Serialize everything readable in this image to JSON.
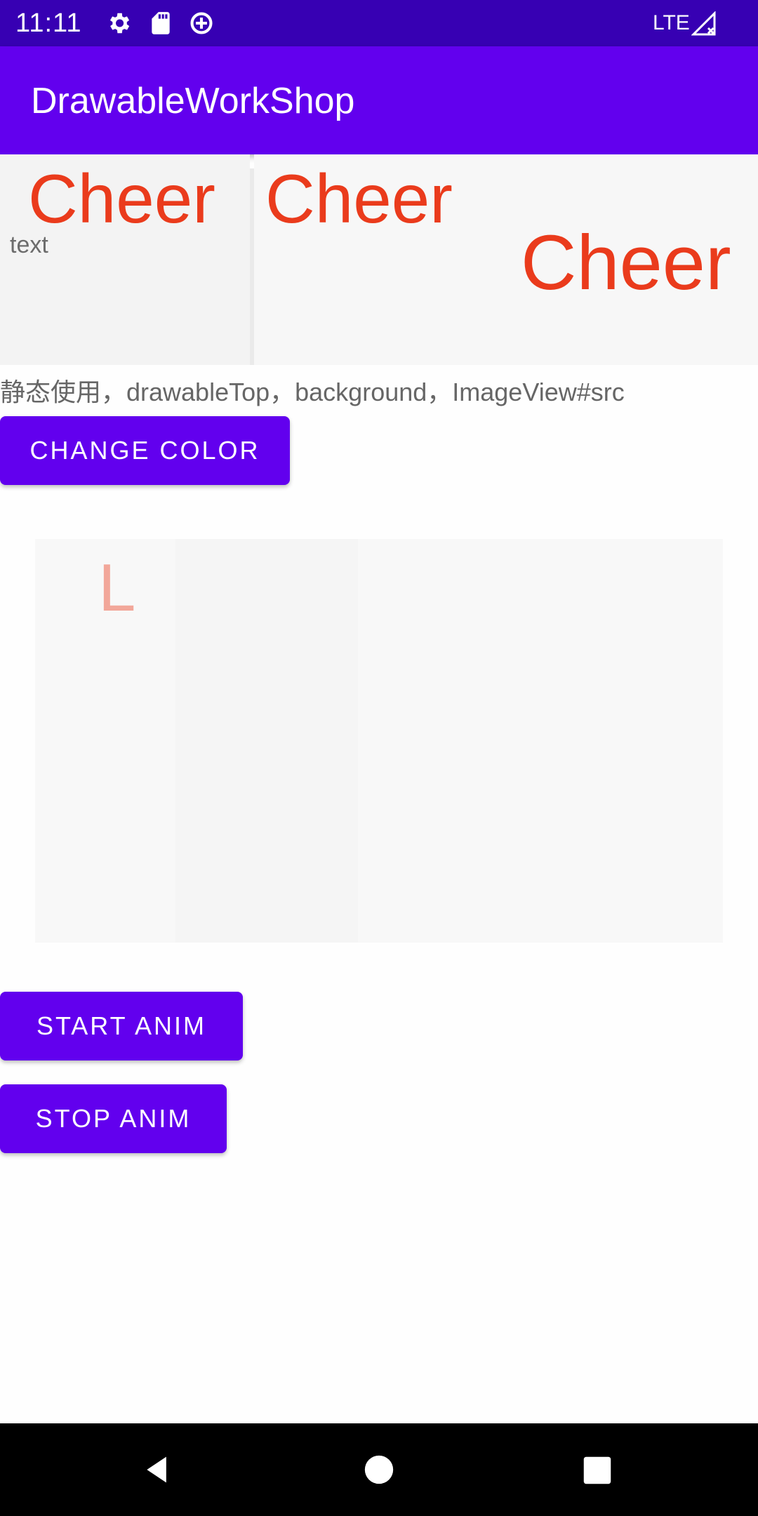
{
  "status_bar": {
    "time": "11:11",
    "icons": [
      "settings-icon",
      "sd-card-icon",
      "data-saver-icon"
    ],
    "network": "LTE",
    "signal_icon": "signal-icon"
  },
  "app_bar": {
    "title": "DrawableWorkShop"
  },
  "content": {
    "cheer_texts": [
      "Cheer",
      "Cheer",
      "Cheer"
    ],
    "small_label": "text",
    "caption": "静态使用，drawableTop，background，ImageView#src",
    "change_color_button": "CHANGE COLOR",
    "anim_letter": "L",
    "start_anim_button": "START ANIM",
    "stop_anim_button": "STOP ANIM"
  },
  "nav_bar": {
    "icons": [
      "back-icon",
      "home-icon",
      "recents-icon"
    ]
  },
  "colors": {
    "status_bar": "#3700b3",
    "app_bar": "#6200ee",
    "button": "#6200ee",
    "cheer_text": "#ea3b1c"
  }
}
